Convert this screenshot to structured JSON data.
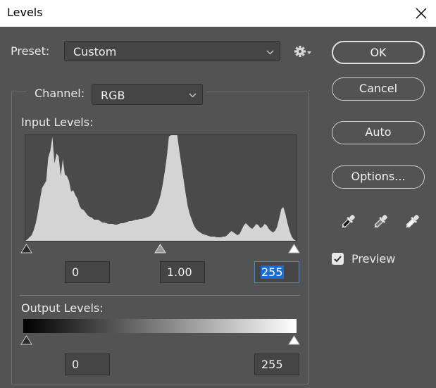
{
  "window": {
    "title": "Levels"
  },
  "preset": {
    "label": "Preset:",
    "value": "Custom"
  },
  "channel": {
    "label": "Channel:",
    "value": "RGB"
  },
  "input_levels": {
    "label": "Input Levels:",
    "black": "0",
    "gamma": "1.00",
    "white": "255"
  },
  "output_levels": {
    "label": "Output Levels:",
    "black": "0",
    "white": "255"
  },
  "buttons": {
    "ok": "OK",
    "cancel": "Cancel",
    "auto": "Auto",
    "options": "Options..."
  },
  "preview": {
    "label": "Preview",
    "checked": true
  },
  "colors": {
    "dialog_bg": "#535353",
    "field_bg": "#454545",
    "histogram_fill": "#d4d4d4",
    "selection": "#1a6bd3"
  },
  "icons": {
    "close": "close-icon",
    "gear": "gear-icon",
    "black_point_eyedropper": "black-eyedropper-icon",
    "gray_point_eyedropper": "gray-eyedropper-icon",
    "white_point_eyedropper": "white-eyedropper-icon"
  },
  "histogram": {
    "counts": [
      0,
      2,
      5,
      8,
      15,
      25,
      40,
      58,
      75,
      80,
      85,
      118,
      128,
      148,
      110,
      124,
      120,
      92,
      116,
      94,
      92,
      85,
      70,
      72,
      65,
      60,
      50,
      45,
      44,
      40,
      36,
      34,
      33,
      30,
      30,
      30,
      28,
      26,
      26,
      25,
      24,
      24,
      24,
      23,
      23,
      24,
      25,
      25,
      26,
      27,
      28,
      28,
      29,
      30,
      30,
      31,
      31,
      32,
      33,
      34,
      35,
      38,
      42,
      48,
      55,
      65,
      80,
      98,
      120,
      148,
      150,
      150,
      150,
      150,
      128,
      108,
      88,
      68,
      50,
      38,
      30,
      22,
      17,
      14,
      12,
      10,
      9,
      8,
      7,
      6,
      6,
      6,
      5,
      5,
      5,
      6,
      6,
      8,
      11,
      14,
      12,
      10,
      8,
      10,
      16,
      22,
      25,
      22,
      19,
      17,
      20,
      24,
      22,
      18,
      20,
      24,
      22,
      17,
      14,
      12,
      14,
      20,
      32,
      45,
      48,
      38,
      25,
      14,
      6,
      2,
      0
    ]
  }
}
